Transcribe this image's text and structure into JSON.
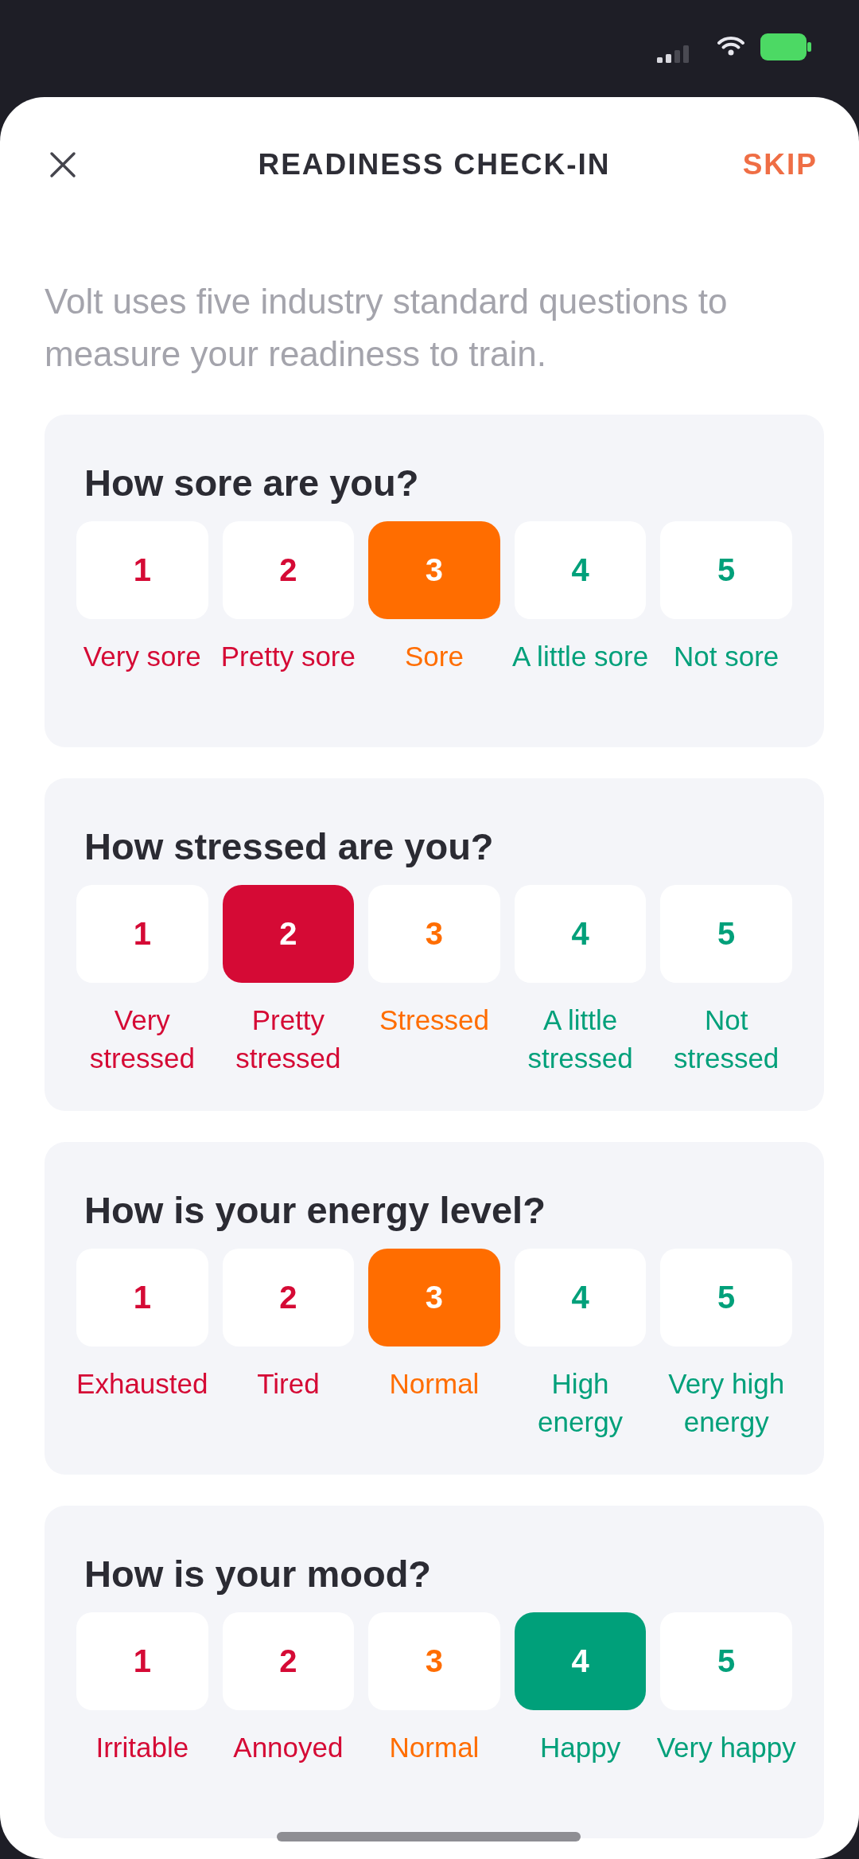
{
  "header": {
    "title": "READINESS CHECK-IN",
    "skip": "SKIP"
  },
  "intro": "Volt uses five industry standard questions to measure your readiness to train.",
  "questions": [
    {
      "title": "How sore are you?",
      "options": [
        {
          "value": "1",
          "label": "Very sore",
          "color": "#d50a35",
          "selected": false
        },
        {
          "value": "2",
          "label": "Pretty sore",
          "color": "#d50a35",
          "selected": false
        },
        {
          "value": "3",
          "label": "Sore",
          "color": "#ff6d00",
          "selected": true
        },
        {
          "value": "4",
          "label": "A little sore",
          "color": "#00a07a",
          "selected": false
        },
        {
          "value": "5",
          "label": "Not sore",
          "color": "#00a07a",
          "selected": false
        }
      ]
    },
    {
      "title": "How stressed are you?",
      "options": [
        {
          "value": "1",
          "label": "Very stressed",
          "color": "#d50a35",
          "selected": false
        },
        {
          "value": "2",
          "label": "Pretty stressed",
          "color": "#d50a35",
          "selected": true
        },
        {
          "value": "3",
          "label": "Stressed",
          "color": "#ff6d00",
          "selected": false
        },
        {
          "value": "4",
          "label": "A little stressed",
          "color": "#00a07a",
          "selected": false
        },
        {
          "value": "5",
          "label": "Not stressed",
          "color": "#00a07a",
          "selected": false
        }
      ]
    },
    {
      "title": "How is your energy level?",
      "options": [
        {
          "value": "1",
          "label": "Exhausted",
          "color": "#d50a35",
          "selected": false
        },
        {
          "value": "2",
          "label": "Tired",
          "color": "#d50a35",
          "selected": false
        },
        {
          "value": "3",
          "label": "Normal",
          "color": "#ff6d00",
          "selected": true
        },
        {
          "value": "4",
          "label": "High energy",
          "color": "#00a07a",
          "selected": false
        },
        {
          "value": "5",
          "label": "Very high energy",
          "color": "#00a07a",
          "selected": false
        }
      ]
    },
    {
      "title": "How is your mood?",
      "options": [
        {
          "value": "1",
          "label": "Irritable",
          "color": "#d50a35",
          "selected": false
        },
        {
          "value": "2",
          "label": "Annoyed",
          "color": "#d50a35",
          "selected": false
        },
        {
          "value": "3",
          "label": "Normal",
          "color": "#ff6d00",
          "selected": false
        },
        {
          "value": "4",
          "label": "Happy",
          "color": "#00a07a",
          "selected": true
        },
        {
          "value": "5",
          "label": "Very happy",
          "color": "#00a07a",
          "selected": false
        }
      ]
    }
  ]
}
